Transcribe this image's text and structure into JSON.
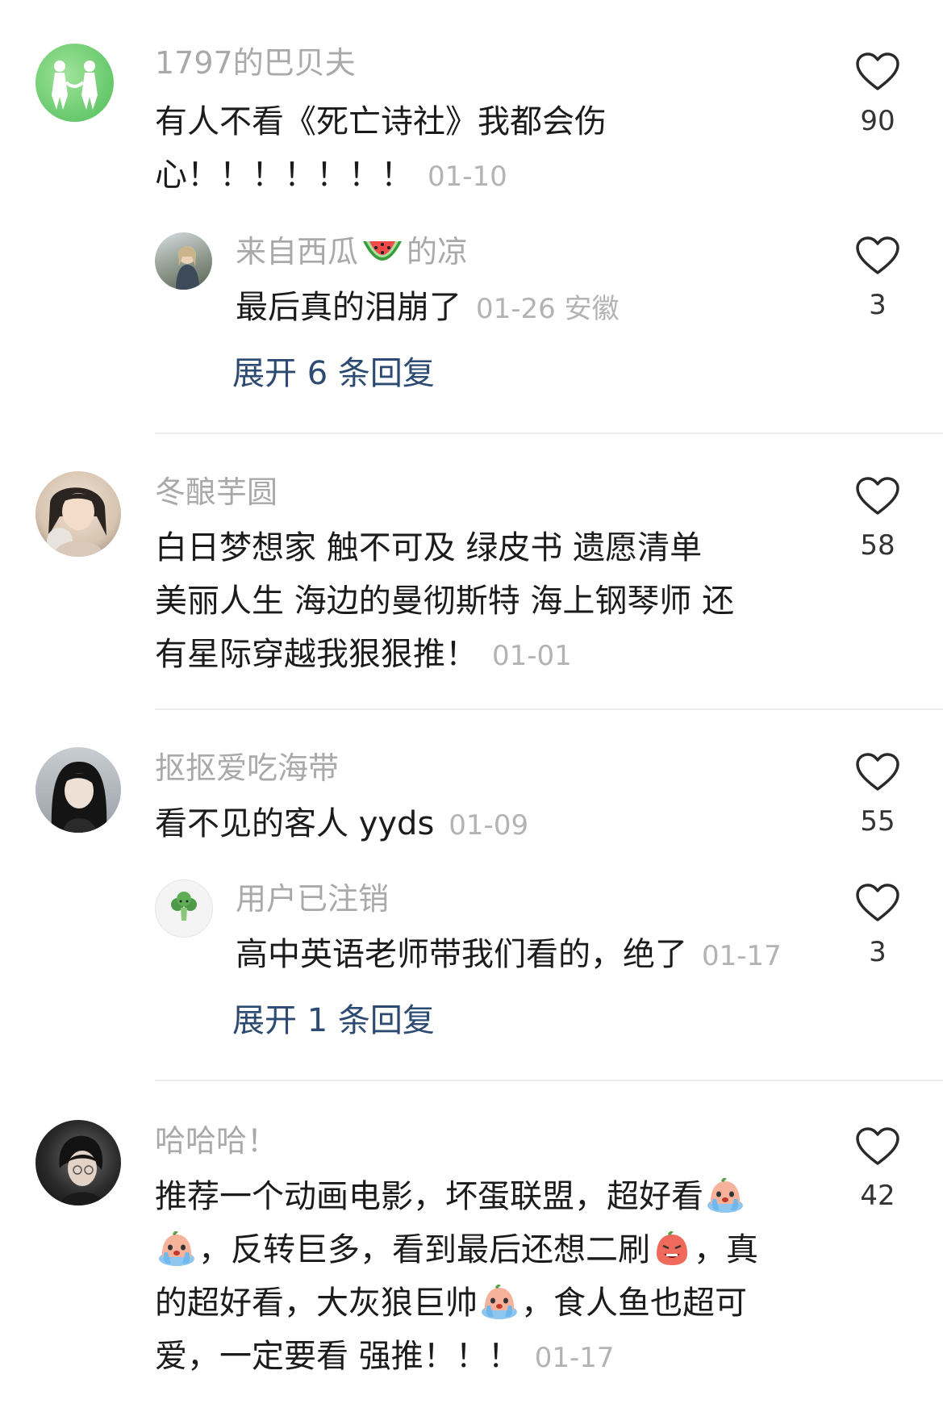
{
  "comments": [
    {
      "username": "1797的巴贝夫",
      "line1": "有人不看《死亡诗社》我都会伤",
      "line2": "心！！！！！！！",
      "date": "01-10",
      "likes": "90",
      "reply": {
        "username_prefix": "来自西瓜",
        "username_suffix": "的凉",
        "text": "最后真的泪崩了",
        "date": "01-26 安徽",
        "likes": "3"
      },
      "expand": "展开 6 条回复"
    },
    {
      "username": "冬酿芋圆",
      "line1": "白日梦想家  触不可及  绿皮书  遗愿清单",
      "line2": "美丽人生  海边的曼彻斯特  海上钢琴师  还",
      "line3": "有星际穿越我狠狠推！",
      "date": "01-01",
      "likes": "58"
    },
    {
      "username": "抠抠爱吃海带",
      "line1": "看不见的客人 yyds",
      "date": "01-09",
      "likes": "55",
      "reply": {
        "username": "用户已注销",
        "text": "高中英语老师带我们看的，绝了",
        "date": "01-17",
        "likes": "3"
      },
      "expand": "展开 1 条回复"
    },
    {
      "username": "哈哈哈！",
      "line1": "推荐一个动画电影，坏蛋联盟，超好看",
      "line2a": "，反转巨多，看到最后还想二刷",
      "line2b": "，真",
      "line3a": "的超好看，大灰狼巨帅",
      "line3b": "，食人鱼也超可",
      "line4": "爱，一定要看 强推！！！",
      "date": "01-17",
      "likes": "42"
    }
  ],
  "icons": {
    "heart": "heart-outline-icon",
    "watermelon": "watermelon-emoji",
    "crying": "crying-emoji",
    "angry": "angry-emoji",
    "broccoli": "broccoli-icon"
  },
  "colors": {
    "username": "#a9a9a9",
    "text": "#1b1b1b",
    "date": "#b3b3b3",
    "expand": "#2c4a72",
    "divider": "#ececec"
  }
}
